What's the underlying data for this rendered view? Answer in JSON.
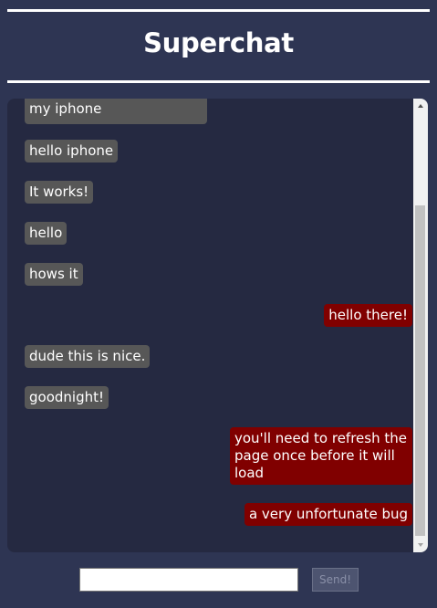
{
  "header": {
    "title": "Superchat"
  },
  "messages": [
    {
      "sender": "other",
      "text": "my iphone"
    },
    {
      "sender": "other",
      "text": "hello iphone"
    },
    {
      "sender": "other",
      "text": "It works!"
    },
    {
      "sender": "other",
      "text": "hello"
    },
    {
      "sender": "other",
      "text": "hows it"
    },
    {
      "sender": "me",
      "text": "hello there!"
    },
    {
      "sender": "other",
      "text": "dude this is nice."
    },
    {
      "sender": "other",
      "text": "goodnight!"
    },
    {
      "sender": "me",
      "text": "you'll need to refresh the page once before it will load"
    },
    {
      "sender": "me",
      "text": "a very unfortunate bug"
    }
  ],
  "composer": {
    "input_value": "",
    "send_label": "Send!"
  },
  "colors": {
    "background": "#2e3553",
    "chat_panel": "#252941",
    "other_bubble": "#575757",
    "own_bubble": "#800000"
  },
  "icons": {
    "scroll_up": "triangle-up",
    "scroll_down": "triangle-down"
  }
}
